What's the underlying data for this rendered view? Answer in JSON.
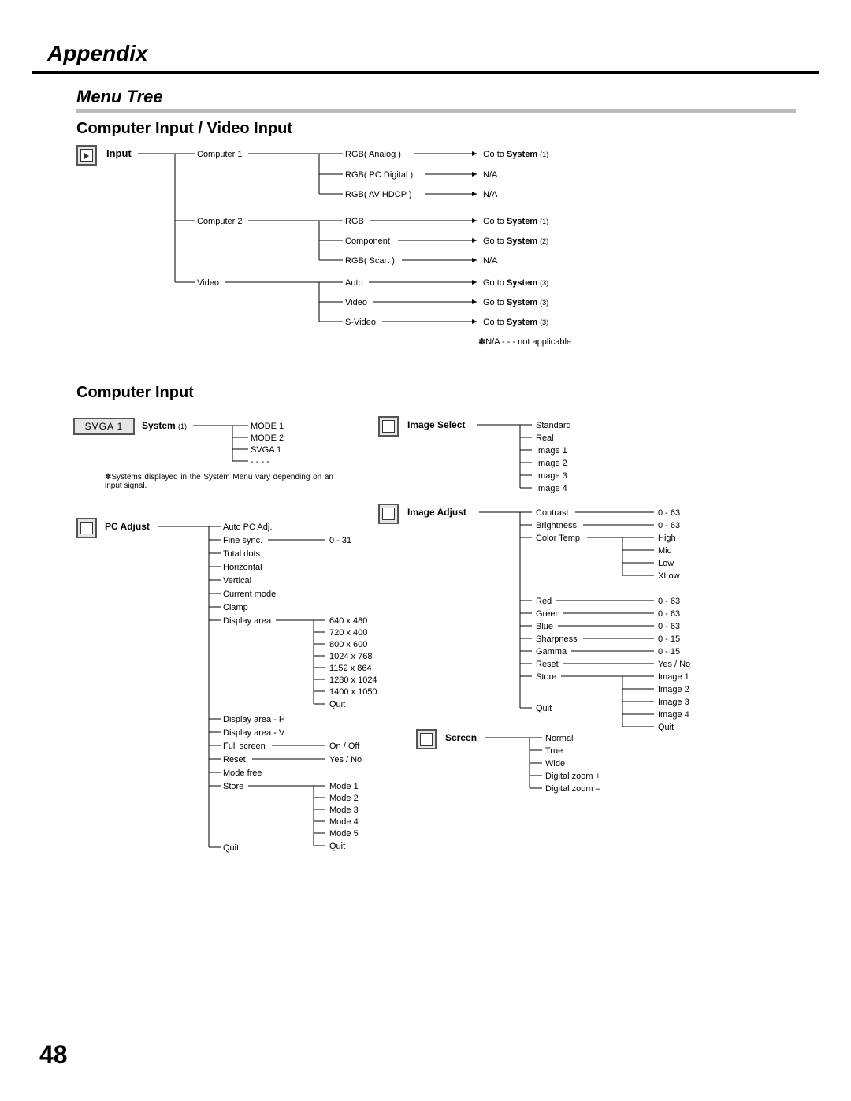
{
  "header": {
    "appendix": "Appendix",
    "menutree": "Menu Tree"
  },
  "section1": {
    "title": "Computer Input / Video Input"
  },
  "section2": {
    "title": "Computer Input"
  },
  "pagenum": "48",
  "input": {
    "label": "Input",
    "computer1": {
      "label": "Computer 1",
      "rgb_analog": "RGB( Analog )",
      "rgb_pc_digital": "RGB( PC Digital )",
      "rgb_av_hdcp": "RGB( AV HDCP )",
      "goto_prefix": "Go to ",
      "system": "System",
      "sys1": "(1)",
      "na": "N/A"
    },
    "computer2": {
      "label": "Computer 2",
      "rgb": "RGB",
      "component": "Component",
      "rgb_scart": "RGB( Scart )",
      "sys2": "(2)"
    },
    "video": {
      "label": "Video",
      "auto": "Auto",
      "video2": "Video",
      "svideo": "S-Video",
      "sys3": "(3)"
    },
    "note": "✽N/A - - - not applicable"
  },
  "system": {
    "badge": "SVGA 1",
    "label": "System",
    "sub": "(1)",
    "mode1": "MODE 1",
    "mode2": "MODE 2",
    "svga1": "SVGA 1",
    "dashes": "- - - -",
    "note": "✽Systems displayed in the System Menu vary depending on an input signal."
  },
  "pcadjust": {
    "label": "PC Adjust",
    "autopc": "Auto PC Adj.",
    "finesync": "Fine sync.",
    "finesync_range": "0 - 31",
    "totaldots": "Total dots",
    "horizontal": "Horizontal",
    "vertical": "Vertical",
    "currentmode": "Current mode",
    "clamp": "Clamp",
    "displayarea": "Display area",
    "res0": "640 x 480",
    "res1": "720 x 400",
    "res2": "800 x 600",
    "res3": "1024 x 768",
    "res4": "1152 x 864",
    "res5": "1280 x 1024",
    "res6": "1400 x 1050",
    "quit": "Quit",
    "displayarea_h": "Display area - H",
    "displayarea_v": "Display area - V",
    "fullscreen": "Full screen",
    "fullscreen_val": "On / Off",
    "reset": "Reset",
    "reset_val": "Yes / No",
    "modefree": "Mode free",
    "store": "Store",
    "mode1": "Mode 1",
    "mode2": "Mode 2",
    "mode3": "Mode 3",
    "mode4": "Mode 4",
    "mode5": "Mode 5",
    "quit2": "Quit",
    "quit3": "Quit"
  },
  "imageselect": {
    "label": "Image Select",
    "standard": "Standard",
    "real": "Real",
    "image1": "Image 1",
    "image2": "Image 2",
    "image3": "Image 3",
    "image4": "Image 4"
  },
  "imageadjust": {
    "label": "Image Adjust",
    "contrast": "Contrast",
    "contrast_val": "0 - 63",
    "brightness": "Brightness",
    "brightness_val": "0 - 63",
    "colortemp": "Color Temp",
    "high": "High",
    "mid": "Mid",
    "low": "Low",
    "xlow": "XLow",
    "red": "Red",
    "red_val": "0 - 63",
    "green": "Green",
    "green_val": "0 - 63",
    "blue": "Blue",
    "blue_val": "0 - 63",
    "sharpness": "Sharpness",
    "sharpness_val": "0 - 15",
    "gamma": "Gamma",
    "gamma_val": "0 - 15",
    "reset": "Reset",
    "reset_val": "Yes / No",
    "store": "Store",
    "image1": "Image 1",
    "image2": "Image 2",
    "image3": "Image 3",
    "image4": "Image 4",
    "quit": "Quit",
    "quit2": "Quit"
  },
  "screen": {
    "label": "Screen",
    "normal": "Normal",
    "true": "True",
    "wide": "Wide",
    "dzoomp": "Digital zoom +",
    "dzoomm": "Digital zoom –"
  }
}
